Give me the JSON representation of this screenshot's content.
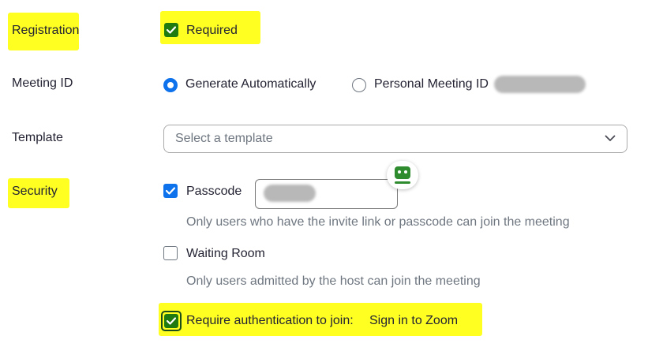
{
  "registration": {
    "label": "Registration",
    "checkbox_label": "Required",
    "checked": true
  },
  "meeting_id": {
    "label": "Meeting ID",
    "options": [
      {
        "label": "Generate Automatically",
        "selected": true
      },
      {
        "label": "Personal Meeting ID",
        "selected": false
      }
    ]
  },
  "template": {
    "label": "Template",
    "placeholder": "Select a template"
  },
  "security": {
    "label": "Security",
    "passcode": {
      "label": "Passcode",
      "checked": true,
      "hint": "Only users who have the invite link or passcode can join the meeting"
    },
    "waiting_room": {
      "label": "Waiting Room",
      "checked": false,
      "hint": "Only users admitted by the host can join the meeting"
    },
    "authentication": {
      "label": "Require authentication to join:",
      "value": "Sign in to Zoom",
      "checked": true
    }
  },
  "colors": {
    "accent": "#0e72ed",
    "highlight": "#ffff22",
    "text": "#232333",
    "hint_text": "#6e7680"
  },
  "icons": {
    "password_manager": "password-manager-icon",
    "dropdown": "chevron-down-icon",
    "check": "check-icon"
  }
}
